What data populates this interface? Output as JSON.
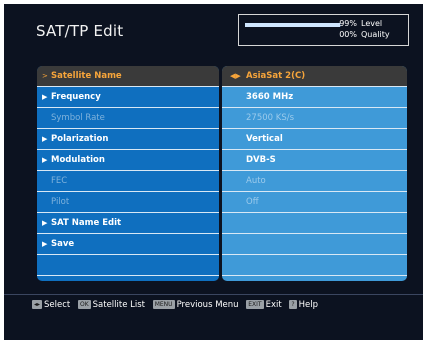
{
  "header": {
    "title": "SAT/TP Edit",
    "signal": {
      "level_value": "99%",
      "level_label": "Level",
      "level_fraction": 0.99,
      "quality_value": "00%",
      "quality_label": "Quality",
      "quality_fraction": 0.0
    }
  },
  "menu": {
    "rows": [
      {
        "label": "Satellite Name",
        "value": "AsiaSat 2(C)",
        "state": "selected"
      },
      {
        "label": "Frequency",
        "value": "3660 MHz",
        "state": "enabled"
      },
      {
        "label": "Symbol Rate",
        "value": "27500 KS/s",
        "state": "disabled"
      },
      {
        "label": "Polarization",
        "value": "Vertical",
        "state": "enabled"
      },
      {
        "label": "Modulation",
        "value": "DVB-S",
        "state": "enabled"
      },
      {
        "label": "FEC",
        "value": "Auto",
        "state": "disabled"
      },
      {
        "label": "Pilot",
        "value": "Off",
        "state": "disabled"
      },
      {
        "label": "SAT Name Edit",
        "value": "",
        "state": "enabled"
      },
      {
        "label": "Save",
        "value": "",
        "state": "enabled"
      }
    ]
  },
  "footer": {
    "select_key": "◂▸",
    "select_label": "Select",
    "ok_key": "OK",
    "ok_label": "Satellite List",
    "menu_key": "MENU",
    "menu_label": "Previous Menu",
    "exit_key": "EXIT",
    "exit_label": "Exit",
    "help_key": "?",
    "help_label": "Help"
  },
  "colors": {
    "left_panel": "#0f6fbf",
    "right_panel": "#3f9ad8",
    "highlight_text": "#f7a53a",
    "background": "#0c1220"
  }
}
